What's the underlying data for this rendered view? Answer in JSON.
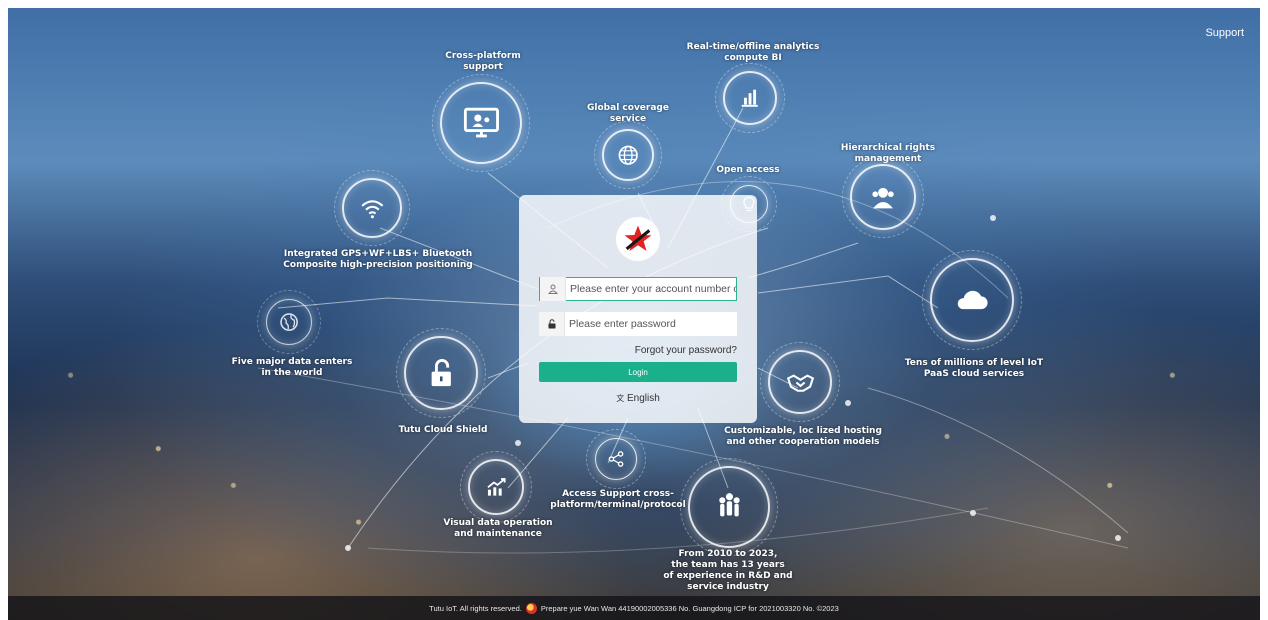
{
  "header": {
    "support_label": "Support"
  },
  "features": {
    "cross_platform": "Cross-platform\nsupport",
    "analytics": "Real-time/offline analytics\ncompute BI",
    "global_coverage": "Global coverage service",
    "open_access": "Open access",
    "rights": "Hierarchical rights management",
    "positioning": "Integrated GPS+WF+LBS+ Bluetooth\nComposite high-precision positioning",
    "cloud": "Tens of millions of level IoT\nPaaS cloud services",
    "data_centers": "Five major data centers\nin the world",
    "shield": "Tutu Cloud Shield",
    "hosting": "Customizable, loc lized hosting\nand other cooperation models",
    "access_support": "Access Support cross-\nplatform/terminal/protocol",
    "visual_ops": "Visual data operation\nand maintenance",
    "experience": "From 2010 to 2023,\nthe team has 13 years\nof experience in R&D and\nservice industry"
  },
  "login": {
    "account_placeholder": "Please enter your account number or c",
    "password_placeholder": "Please enter password",
    "forgot_label": "Forgot your password?",
    "login_label": "Login",
    "lang_label": "English",
    "lang_glyph": "文"
  },
  "footer": {
    "left_text": "Tutu IoT. All rights reserved.",
    "right_text": "Prepare yue Wan Wan 44190002005336 No.  Guangdong ICP for 2021003320 No. ©2023"
  },
  "icons": {
    "cross_platform": "monitor-user-icon",
    "analytics": "bar-chart-icon",
    "global_coverage": "globe-icon",
    "open_access": "lightbulb-icon",
    "rights": "user-group-icon",
    "positioning": "wifi-icon",
    "cloud": "cloud-icon",
    "data_centers": "earth-icon",
    "shield": "unlock-icon",
    "hosting": "handshake-icon",
    "access_support": "share-icon",
    "visual_ops": "trend-chart-icon",
    "experience": "team-icon"
  },
  "colors": {
    "accent": "#1bb08c",
    "active_border": "#2fb38a",
    "brand_red": "#e02424"
  }
}
